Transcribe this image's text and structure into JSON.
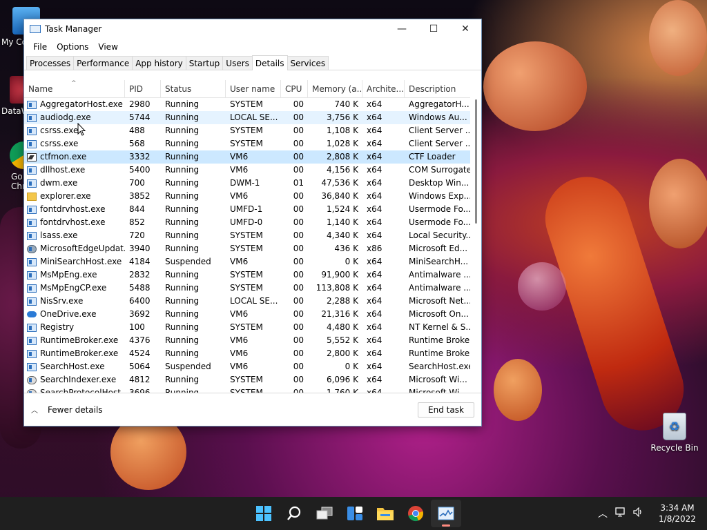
{
  "window": {
    "title": "Task Manager",
    "controls": {
      "minimize": "—",
      "maximize": "☐",
      "close": "✕"
    }
  },
  "menu": [
    "File",
    "Options",
    "View"
  ],
  "tabs": [
    {
      "label": "Processes",
      "active": false
    },
    {
      "label": "Performance",
      "active": false
    },
    {
      "label": "App history",
      "active": false
    },
    {
      "label": "Startup",
      "active": false
    },
    {
      "label": "Users",
      "active": false
    },
    {
      "label": "Details",
      "active": true
    },
    {
      "label": "Services",
      "active": false
    }
  ],
  "columns": [
    "Name",
    "PID",
    "Status",
    "User name",
    "CPU",
    "Memory (a...",
    "Archite...",
    "Description"
  ],
  "rows": [
    {
      "icon": "app-icon",
      "name": "AggregatorHost.exe",
      "pid": "2980",
      "status": "Running",
      "user": "SYSTEM",
      "cpu": "00",
      "mem": "740 K",
      "arch": "x64",
      "desc": "AggregatorH..."
    },
    {
      "icon": "app-icon",
      "name": "audiodg.exe",
      "pid": "5744",
      "status": "Running",
      "user": "LOCAL SE...",
      "cpu": "00",
      "mem": "3,756 K",
      "arch": "x64",
      "desc": "Windows Au...",
      "state": "hover"
    },
    {
      "icon": "app-icon",
      "name": "csrss.exe",
      "pid": "488",
      "status": "Running",
      "user": "SYSTEM",
      "cpu": "00",
      "mem": "1,108 K",
      "arch": "x64",
      "desc": "Client Server ..."
    },
    {
      "icon": "app-icon",
      "name": "csrss.exe",
      "pid": "568",
      "status": "Running",
      "user": "SYSTEM",
      "cpu": "00",
      "mem": "1,028 K",
      "arch": "x64",
      "desc": "Client Server ..."
    },
    {
      "icon": "pen-icon",
      "name": "ctfmon.exe",
      "pid": "3332",
      "status": "Running",
      "user": "VM6",
      "cpu": "00",
      "mem": "2,808 K",
      "arch": "x64",
      "desc": "CTF Loader",
      "state": "selected"
    },
    {
      "icon": "app-icon",
      "name": "dllhost.exe",
      "pid": "5400",
      "status": "Running",
      "user": "VM6",
      "cpu": "00",
      "mem": "4,156 K",
      "arch": "x64",
      "desc": "COM Surrogate"
    },
    {
      "icon": "app-icon",
      "name": "dwm.exe",
      "pid": "700",
      "status": "Running",
      "user": "DWM-1",
      "cpu": "01",
      "mem": "47,536 K",
      "arch": "x64",
      "desc": "Desktop Win..."
    },
    {
      "icon": "folder-icon",
      "name": "explorer.exe",
      "pid": "3852",
      "status": "Running",
      "user": "VM6",
      "cpu": "00",
      "mem": "36,840 K",
      "arch": "x64",
      "desc": "Windows Exp..."
    },
    {
      "icon": "app-icon",
      "name": "fontdrvhost.exe",
      "pid": "844",
      "status": "Running",
      "user": "UMFD-1",
      "cpu": "00",
      "mem": "1,524 K",
      "arch": "x64",
      "desc": "Usermode Fo..."
    },
    {
      "icon": "app-icon",
      "name": "fontdrvhost.exe",
      "pid": "852",
      "status": "Running",
      "user": "UMFD-0",
      "cpu": "00",
      "mem": "1,140 K",
      "arch": "x64",
      "desc": "Usermode Fo..."
    },
    {
      "icon": "app-icon",
      "name": "lsass.exe",
      "pid": "720",
      "status": "Running",
      "user": "SYSTEM",
      "cpu": "00",
      "mem": "4,340 K",
      "arch": "x64",
      "desc": "Local Security..."
    },
    {
      "icon": "edge-icon",
      "name": "MicrosoftEdgeUpdat...",
      "pid": "3940",
      "status": "Running",
      "user": "SYSTEM",
      "cpu": "00",
      "mem": "436 K",
      "arch": "x86",
      "desc": "Microsoft Ed..."
    },
    {
      "icon": "app-icon",
      "name": "MiniSearchHost.exe",
      "pid": "4184",
      "status": "Suspended",
      "user": "VM6",
      "cpu": "00",
      "mem": "0 K",
      "arch": "x64",
      "desc": "MiniSearchH..."
    },
    {
      "icon": "app-icon",
      "name": "MsMpEng.exe",
      "pid": "2832",
      "status": "Running",
      "user": "SYSTEM",
      "cpu": "00",
      "mem": "91,900 K",
      "arch": "x64",
      "desc": "Antimalware ..."
    },
    {
      "icon": "app-icon",
      "name": "MsMpEngCP.exe",
      "pid": "5488",
      "status": "Running",
      "user": "SYSTEM",
      "cpu": "00",
      "mem": "113,808 K",
      "arch": "x64",
      "desc": "Antimalware ..."
    },
    {
      "icon": "app-icon",
      "name": "NisSrv.exe",
      "pid": "6400",
      "status": "Running",
      "user": "LOCAL SE...",
      "cpu": "00",
      "mem": "2,288 K",
      "arch": "x64",
      "desc": "Microsoft Net..."
    },
    {
      "icon": "cloud-icon",
      "name": "OneDrive.exe",
      "pid": "3692",
      "status": "Running",
      "user": "VM6",
      "cpu": "00",
      "mem": "21,316 K",
      "arch": "x64",
      "desc": "Microsoft On..."
    },
    {
      "icon": "app-icon",
      "name": "Registry",
      "pid": "100",
      "status": "Running",
      "user": "SYSTEM",
      "cpu": "00",
      "mem": "4,480 K",
      "arch": "x64",
      "desc": "NT Kernel & S..."
    },
    {
      "icon": "app-icon",
      "name": "RuntimeBroker.exe",
      "pid": "4376",
      "status": "Running",
      "user": "VM6",
      "cpu": "00",
      "mem": "5,552 K",
      "arch": "x64",
      "desc": "Runtime Broker"
    },
    {
      "icon": "app-icon",
      "name": "RuntimeBroker.exe",
      "pid": "4524",
      "status": "Running",
      "user": "VM6",
      "cpu": "00",
      "mem": "2,800 K",
      "arch": "x64",
      "desc": "Runtime Broker"
    },
    {
      "icon": "app-icon",
      "name": "SearchHost.exe",
      "pid": "5064",
      "status": "Suspended",
      "user": "VM6",
      "cpu": "00",
      "mem": "0 K",
      "arch": "x64",
      "desc": "SearchHost.exe"
    },
    {
      "icon": "search-icon",
      "name": "SearchIndexer.exe",
      "pid": "4812",
      "status": "Running",
      "user": "SYSTEM",
      "cpu": "00",
      "mem": "6,096 K",
      "arch": "x64",
      "desc": "Microsoft Wi..."
    },
    {
      "icon": "search-icon",
      "name": "SearchProtocolHost...",
      "pid": "3696",
      "status": "Running",
      "user": "SYSTEM",
      "cpu": "00",
      "mem": "1,760 K",
      "arch": "x64",
      "desc": "Microsoft Wi..."
    }
  ],
  "footer": {
    "fewer_details": "Fewer details",
    "end_task": "End task"
  },
  "desktop": {
    "icons": [
      {
        "label": "My Co",
        "icon": "computer-icon"
      },
      {
        "label": "DataW",
        "icon": "datawrapper-icon"
      },
      {
        "label": "Go\nChr",
        "icon": "chrome-icon"
      }
    ],
    "recycle_bin": "Recycle Bin"
  },
  "taskbar": {
    "apps": [
      "windows-start-icon",
      "search-icon",
      "task-view-icon",
      "widgets-icon",
      "file-explorer-icon",
      "chrome-icon",
      "task-manager-icon"
    ],
    "time": "3:34 AM",
    "date": "1/8/2022"
  }
}
